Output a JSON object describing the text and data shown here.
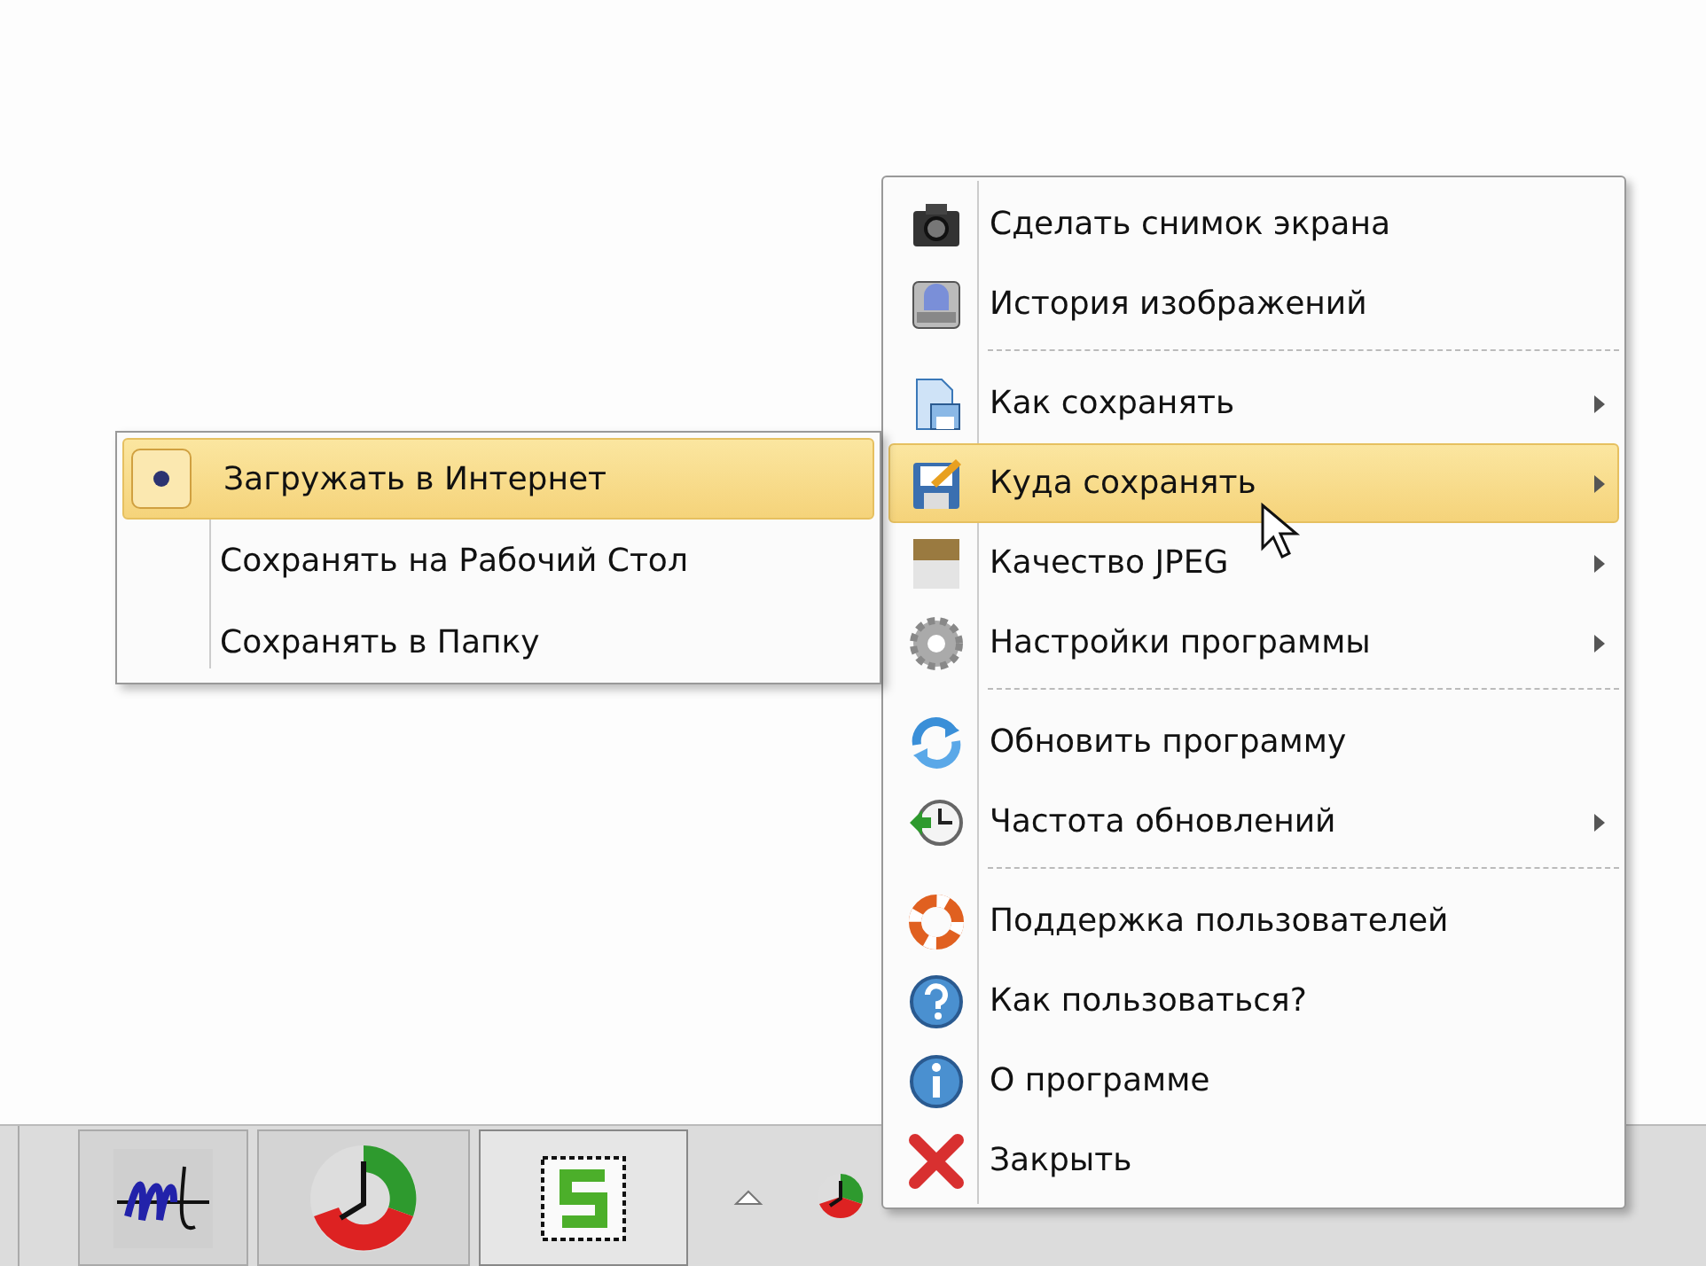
{
  "context_menu": {
    "items": [
      {
        "kind": "item",
        "label": "Сделать снимок экрана",
        "has_submenu": false,
        "selected": false
      },
      {
        "kind": "item",
        "label": "История изображений",
        "has_submenu": false,
        "selected": false
      },
      {
        "kind": "separator"
      },
      {
        "kind": "item",
        "label": "Как сохранять",
        "has_submenu": true,
        "selected": false
      },
      {
        "kind": "item",
        "label": "Куда сохранять",
        "has_submenu": true,
        "selected": true
      },
      {
        "kind": "item",
        "label": "Качество JPEG",
        "has_submenu": true,
        "selected": false
      },
      {
        "kind": "item",
        "label": "Настройки программы",
        "has_submenu": true,
        "selected": false
      },
      {
        "kind": "separator"
      },
      {
        "kind": "item",
        "label": "Обновить программу",
        "has_submenu": false,
        "selected": false
      },
      {
        "kind": "item",
        "label": "Частота обновлений",
        "has_submenu": true,
        "selected": false
      },
      {
        "kind": "separator"
      },
      {
        "kind": "item",
        "label": "Поддержка пользователей",
        "has_submenu": false,
        "selected": false
      },
      {
        "kind": "item",
        "label": "Как пользоваться?",
        "has_submenu": false,
        "selected": false
      },
      {
        "kind": "item",
        "label": "О программе",
        "has_submenu": false,
        "selected": false
      },
      {
        "kind": "item",
        "label": "Закрыть",
        "has_submenu": false,
        "selected": false
      }
    ]
  },
  "submenu": {
    "items": [
      {
        "label": "Загружать в Интернет",
        "checked": true,
        "selected": true
      },
      {
        "label": "Сохранять на Рабочий Стол",
        "checked": false,
        "selected": false
      },
      {
        "label": "Сохранять в Папку",
        "checked": false,
        "selected": false
      }
    ]
  }
}
